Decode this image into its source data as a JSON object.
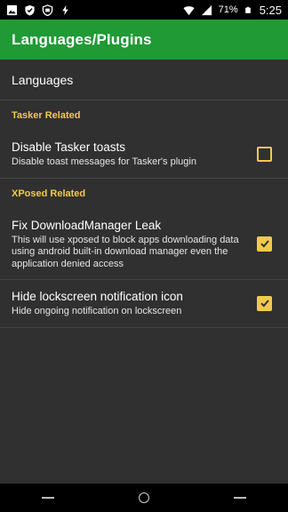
{
  "status_bar": {
    "left_icons": [
      "image-icon",
      "check-shield-icon",
      "shield-outline-icon",
      "charging-bolt-icon"
    ],
    "right_icons": [
      "wifi-icon",
      "signal-icon"
    ],
    "battery": "71%",
    "time": "5:25"
  },
  "app_bar": {
    "title": "Languages/Plugins"
  },
  "languages_item": {
    "label": "Languages"
  },
  "sections": [
    {
      "header": "Tasker Related",
      "prefs": [
        {
          "title": "Disable Tasker toasts",
          "summary": "Disable toast messages for Tasker's plugin",
          "checked": false
        }
      ]
    },
    {
      "header": "XPosed Related",
      "prefs": [
        {
          "title": "Fix DownloadManager Leak",
          "summary": "This will use xposed to block apps downloading data using android built-in download manager even the application denied access",
          "checked": true
        },
        {
          "title": "Hide lockscreen notification icon",
          "summary": "Hide ongoing notification on lockscreen",
          "checked": true
        }
      ]
    }
  ],
  "nav_bar": {
    "buttons": [
      "back-line-icon",
      "home-circle-icon",
      "recents-line-icon"
    ]
  },
  "colors": {
    "accent": "#1f9a35",
    "category": "#f2c94c",
    "background": "#303030"
  }
}
